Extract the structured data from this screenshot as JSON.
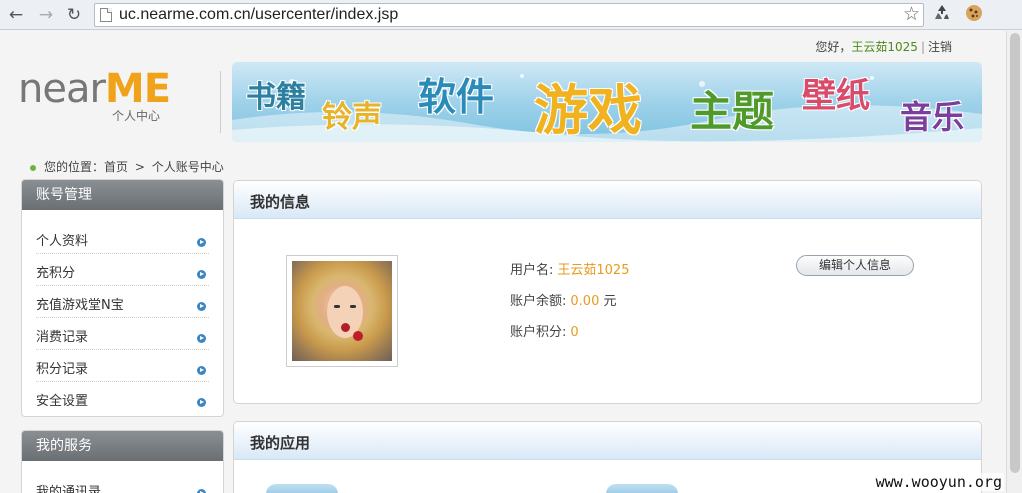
{
  "browser": {
    "url": "uc.nearme.com.cn/usercenter/index.jsp",
    "back_glyph": "←",
    "forward_glyph": "→",
    "reload_glyph": "↻",
    "star_glyph": "☆",
    "icons": [
      "back-icon",
      "forward-icon",
      "reload-icon",
      "page-icon",
      "bookmark-star-icon",
      "recycle-extension-icon",
      "cookie-extension-icon"
    ]
  },
  "header": {
    "greeting_prefix": "您好，",
    "username": "王云茹1025",
    "separator": "|",
    "logout_label": "注销"
  },
  "logo": {
    "near": "near",
    "me": "ME",
    "subtitle": "个人中心",
    "colors": {
      "near": "#777777",
      "me": "#f0a21a"
    }
  },
  "banner": {
    "words": [
      "书籍",
      "铃声",
      "软件",
      "游戏",
      "主题",
      "壁纸",
      "音乐"
    ]
  },
  "breadcrumb": {
    "prefix": "您的位置：",
    "home": "首页",
    "arrow": ">",
    "current": "个人账号中心"
  },
  "sidebar": {
    "account": {
      "title": "账号管理",
      "items": [
        {
          "label": "个人资料"
        },
        {
          "label": "充积分"
        },
        {
          "label": "充值游戏堂N宝"
        },
        {
          "label": "消费记录"
        },
        {
          "label": "积分记录"
        },
        {
          "label": "安全设置"
        }
      ]
    },
    "services": {
      "title": "我的服务",
      "items": [
        {
          "label": "我的通讯录"
        }
      ]
    }
  },
  "my_info": {
    "title": "我的信息",
    "username_label": "用户名:",
    "username_value": "王云茹1025",
    "balance_label": "账户余额:",
    "balance_value": "0.00",
    "balance_unit": "元",
    "points_label": "账户积分:",
    "points_value": "0",
    "edit_button": "编辑个人信息"
  },
  "my_apps": {
    "title": "我的应用"
  },
  "watermark": "www.wooyun.org",
  "colors": {
    "accent_orange": "#e89a1f",
    "username_green": "#4d8a1e",
    "sidebar_header": "#6a6f74",
    "arrow_blue": "#3c86c4"
  }
}
